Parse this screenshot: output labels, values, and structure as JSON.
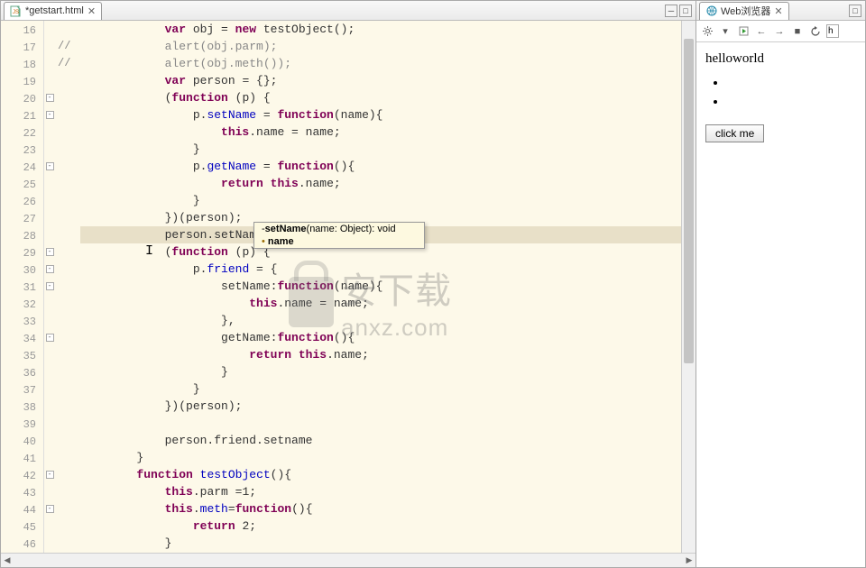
{
  "editor": {
    "tab": {
      "title": "*getstart.html",
      "close": "✕"
    },
    "controls": {
      "minimize": "─",
      "maximize": "□"
    },
    "lineStart": 16,
    "comments": [
      "",
      "//",
      "//",
      "",
      "",
      "",
      "",
      "",
      "",
      "",
      "",
      "",
      "",
      "",
      "",
      "",
      "",
      "",
      "",
      "",
      "",
      "",
      "",
      "",
      "",
      "",
      "",
      "",
      "",
      "",
      ""
    ],
    "folds": {
      "20": "-",
      "21": "-",
      "24": "-",
      "29": "-",
      "30": "-",
      "31": "-",
      "34": "-",
      "42": "-",
      "44": "-"
    },
    "lines": [
      [
        {
          "t": "            "
        },
        {
          "t": "var",
          "c": "kw"
        },
        {
          "t": " obj = "
        },
        {
          "t": "new",
          "c": "kw"
        },
        {
          "t": " testObject();"
        }
      ],
      [
        {
          "t": "            alert(obj.parm);",
          "c": "comment-text"
        }
      ],
      [
        {
          "t": "            alert(obj.meth());",
          "c": "comment-text"
        }
      ],
      [
        {
          "t": "            "
        },
        {
          "t": "var",
          "c": "kw"
        },
        {
          "t": " person = {};"
        }
      ],
      [
        {
          "t": "            ("
        },
        {
          "t": "function",
          "c": "kw"
        },
        {
          "t": " (p) {"
        }
      ],
      [
        {
          "t": "                p."
        },
        {
          "t": "setName",
          "c": "prop"
        },
        {
          "t": " = "
        },
        {
          "t": "function",
          "c": "kw"
        },
        {
          "t": "(name){"
        }
      ],
      [
        {
          "t": "                    "
        },
        {
          "t": "this",
          "c": "this"
        },
        {
          "t": ".name = name;"
        }
      ],
      [
        {
          "t": "                }"
        }
      ],
      [
        {
          "t": "                p."
        },
        {
          "t": "getName",
          "c": "prop"
        },
        {
          "t": " = "
        },
        {
          "t": "function",
          "c": "kw"
        },
        {
          "t": "(){"
        }
      ],
      [
        {
          "t": "                    "
        },
        {
          "t": "return",
          "c": "kw"
        },
        {
          "t": " "
        },
        {
          "t": "this",
          "c": "this"
        },
        {
          "t": ".name;"
        }
      ],
      [
        {
          "t": "                }"
        }
      ],
      [
        {
          "t": "            })(person);"
        }
      ],
      [
        {
          "t": "            person.setName()"
        }
      ],
      [
        {
          "t": "            ("
        },
        {
          "t": "function",
          "c": "kw"
        },
        {
          "t": " (p) {"
        }
      ],
      [
        {
          "t": "                p."
        },
        {
          "t": "friend",
          "c": "prop"
        },
        {
          "t": " = {"
        }
      ],
      [
        {
          "t": "                    setName:"
        },
        {
          "t": "function",
          "c": "kw"
        },
        {
          "t": "(name){"
        }
      ],
      [
        {
          "t": "                        "
        },
        {
          "t": "this",
          "c": "this"
        },
        {
          "t": ".name = name;"
        }
      ],
      [
        {
          "t": "                    },"
        }
      ],
      [
        {
          "t": "                    getName:"
        },
        {
          "t": "function",
          "c": "kw"
        },
        {
          "t": "(){"
        }
      ],
      [
        {
          "t": "                        "
        },
        {
          "t": "return",
          "c": "kw"
        },
        {
          "t": " "
        },
        {
          "t": "this",
          "c": "this"
        },
        {
          "t": ".name;"
        }
      ],
      [
        {
          "t": "                    }"
        }
      ],
      [
        {
          "t": "                }"
        }
      ],
      [
        {
          "t": "            })(person);"
        }
      ],
      [
        {
          "t": ""
        }
      ],
      [
        {
          "t": "            person.friend.setname"
        }
      ],
      [
        {
          "t": "        }"
        }
      ],
      [
        {
          "t": "        "
        },
        {
          "t": "function",
          "c": "kw"
        },
        {
          "t": " "
        },
        {
          "t": "testObject",
          "c": "fn"
        },
        {
          "t": "(){"
        }
      ],
      [
        {
          "t": "            "
        },
        {
          "t": "this",
          "c": "this"
        },
        {
          "t": ".parm =1;"
        }
      ],
      [
        {
          "t": "            "
        },
        {
          "t": "this",
          "c": "this"
        },
        {
          "t": "."
        },
        {
          "t": "meth",
          "c": "prop"
        },
        {
          "t": "="
        },
        {
          "t": "function",
          "c": "kw"
        },
        {
          "t": "(){"
        }
      ],
      [
        {
          "t": "                "
        },
        {
          "t": "return",
          "c": "kw"
        },
        {
          "t": " 2;"
        }
      ],
      [
        {
          "t": "            }"
        }
      ]
    ],
    "currentLine": 28,
    "completion": {
      "line1_prefix": "-",
      "line1_bold": "setName",
      "line1_rest": "(name: Object): void",
      "line2_prefix": "•",
      "line2_bold": "name"
    }
  },
  "browser": {
    "tab": {
      "title": "Web浏览器",
      "close": "✕"
    },
    "url_fragment": "h",
    "content": {
      "heading": "helloworld",
      "button": "click me"
    }
  },
  "watermark": {
    "cn": "安下载",
    "en": "anxz.com"
  }
}
